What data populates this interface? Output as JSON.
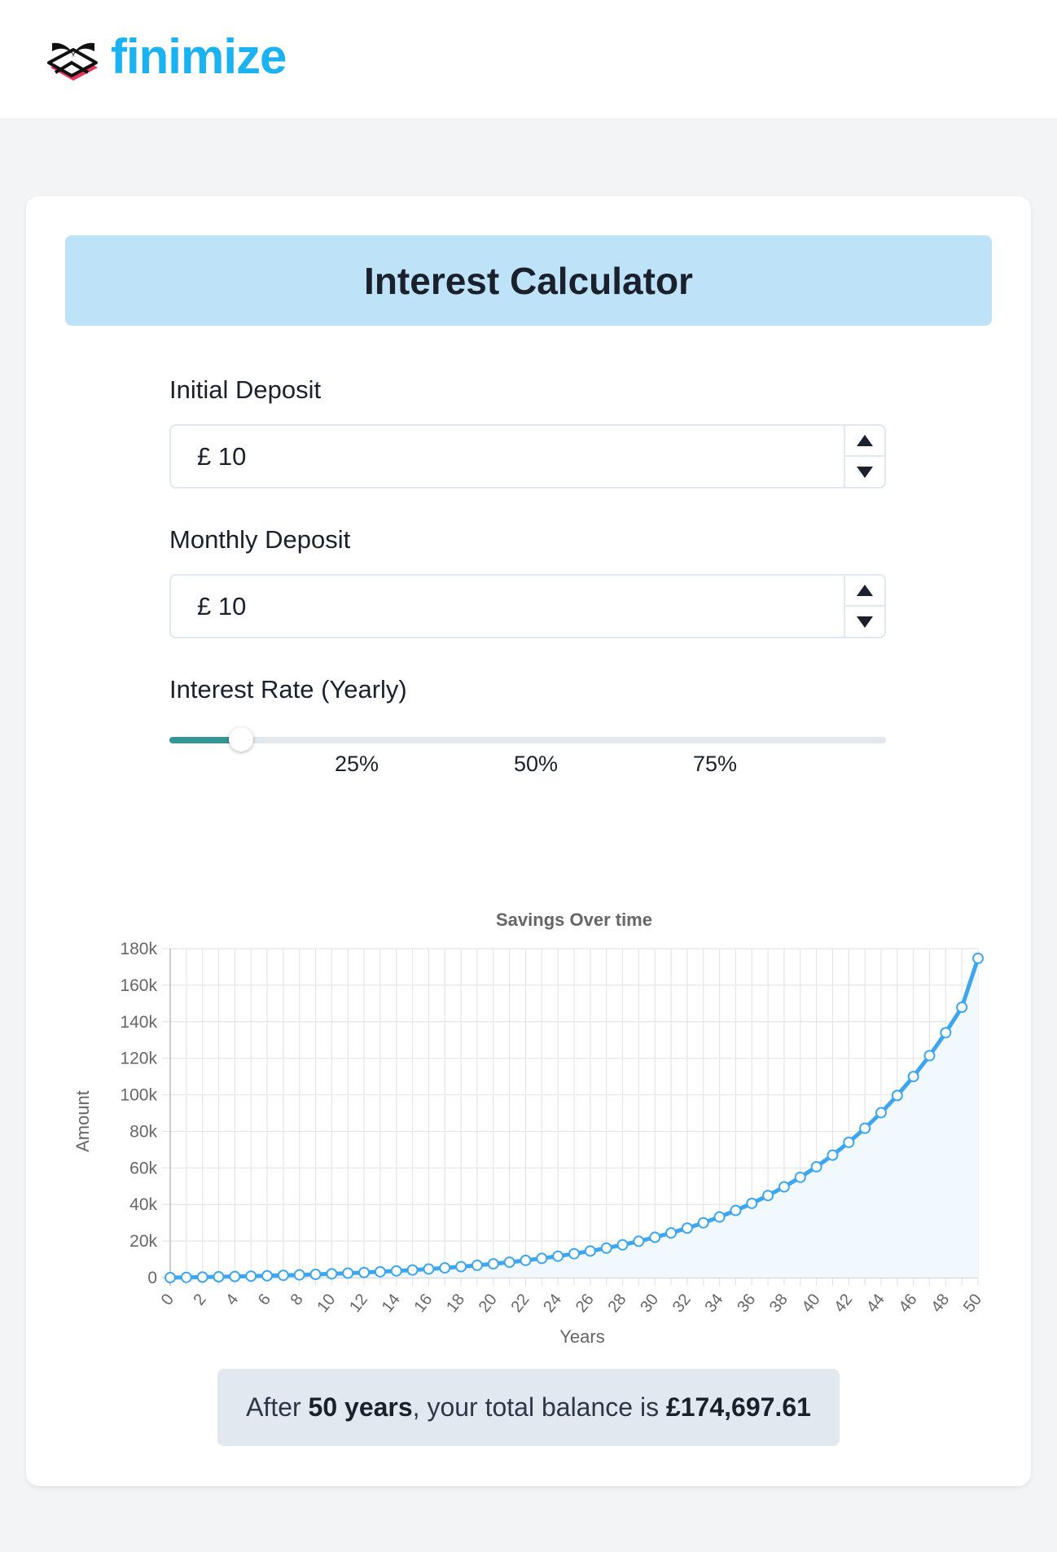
{
  "brand": {
    "name": "finimize",
    "color": "#1bb2f2"
  },
  "calculator": {
    "title": "Interest Calculator",
    "initial_deposit": {
      "label": "Initial Deposit",
      "value": "£ 10"
    },
    "monthly_deposit": {
      "label": "Monthly Deposit",
      "value": "£ 10"
    },
    "interest_rate": {
      "label": "Interest Rate (Yearly)",
      "value_fraction": 0.1,
      "marks": [
        "25%",
        "50%",
        "75%"
      ],
      "fill_color": "#319795"
    },
    "summary": {
      "prefix": "After",
      "years": "50 years",
      "middle": ", your total balance is",
      "amount": "£174,697.61"
    }
  },
  "chart_data": {
    "type": "line",
    "title": "Savings Over time",
    "xlabel": "Years",
    "ylabel": "Amount",
    "x": [
      0,
      1,
      2,
      3,
      4,
      5,
      6,
      7,
      8,
      9,
      10,
      11,
      12,
      13,
      14,
      15,
      16,
      17,
      18,
      19,
      20,
      21,
      22,
      23,
      24,
      25,
      26,
      27,
      28,
      29,
      30,
      31,
      32,
      33,
      34,
      35,
      36,
      37,
      38,
      39,
      40,
      41,
      42,
      43,
      44,
      45,
      46,
      47,
      48,
      49,
      50
    ],
    "values": [
      10,
      138,
      279,
      434,
      606,
      795,
      1003,
      1232,
      1485,
      1764,
      2071,
      2409,
      2782,
      3193,
      3646,
      4146,
      4697,
      5305,
      5975,
      6714,
      7529,
      8428,
      9419,
      10512,
      11717,
      13046,
      14512,
      16128,
      17910,
      19876,
      22043,
      24433,
      27069,
      29975,
      33180,
      36714,
      40611,
      44908,
      49648,
      54873,
      60635,
      66990,
      73997,
      81723,
      90243,
      99639,
      110000,
      121425,
      134024,
      147917,
      174698
    ],
    "xticks": [
      "0",
      "2",
      "4",
      "6",
      "8",
      "10",
      "12",
      "14",
      "16",
      "18",
      "20",
      "22",
      "24",
      "26",
      "28",
      "30",
      "32",
      "34",
      "36",
      "38",
      "40",
      "42",
      "44",
      "46",
      "48",
      "50"
    ],
    "yticks": [
      "0",
      "20k",
      "40k",
      "60k",
      "80k",
      "100k",
      "120k",
      "140k",
      "160k",
      "180k"
    ],
    "ylim": [
      0,
      180000
    ],
    "xlim": [
      0,
      50
    ],
    "grid": true,
    "line_color": "#3ea6ee",
    "fill_color": "#f1f8fe"
  }
}
